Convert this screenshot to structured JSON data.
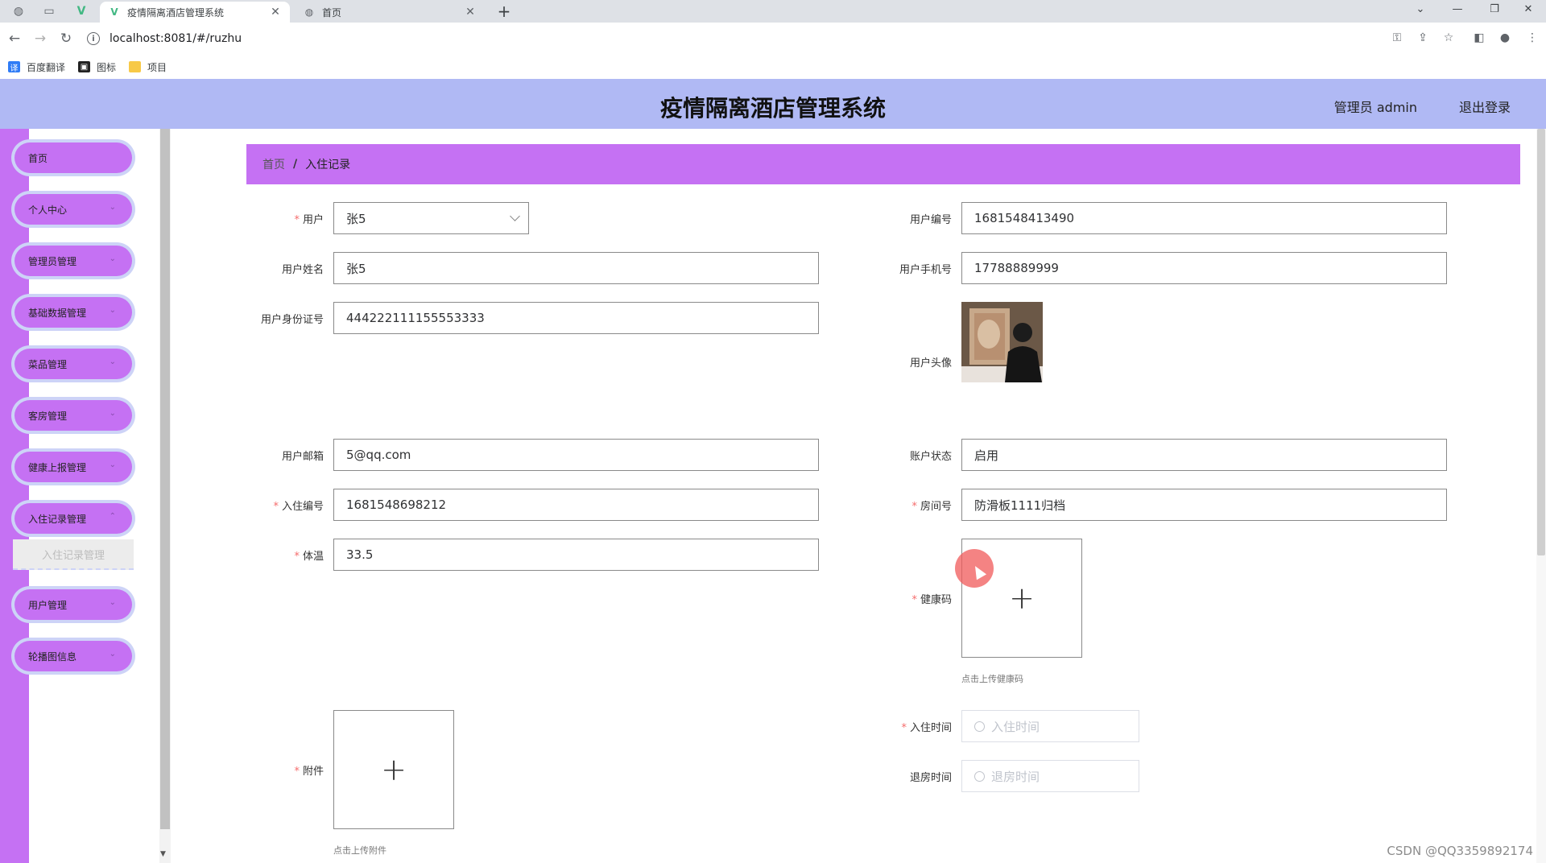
{
  "browser": {
    "tabs": [
      {
        "title": "疫情隔离酒店管理系统",
        "active": true
      },
      {
        "title": "首页",
        "active": false
      }
    ],
    "url": "localhost:8081/#/ruzhu",
    "bookmarks": [
      "百度翻译",
      "图标",
      "项目"
    ]
  },
  "header": {
    "title": "疫情隔离酒店管理系统",
    "admin_label": "管理员 admin",
    "logout_label": "退出登录"
  },
  "sidebar": {
    "items": [
      {
        "label": "首页",
        "has_chevron": false
      },
      {
        "label": "个人中心",
        "has_chevron": true
      },
      {
        "label": "管理员管理",
        "has_chevron": true
      },
      {
        "label": "基础数据管理",
        "has_chevron": true
      },
      {
        "label": "菜品管理",
        "has_chevron": true
      },
      {
        "label": "客房管理",
        "has_chevron": true
      },
      {
        "label": "健康上报管理",
        "has_chevron": true
      },
      {
        "label": "入住记录管理",
        "has_chevron": true
      },
      {
        "label": "用户管理",
        "has_chevron": true
      },
      {
        "label": "轮播图信息",
        "has_chevron": true
      }
    ],
    "submenu_active": "入住记录管理"
  },
  "breadcrumb": {
    "home": "首页",
    "current": "入住记录"
  },
  "form": {
    "user": {
      "label": "用户",
      "value": "张5",
      "required": true
    },
    "user_no": {
      "label": "用户编号",
      "value": "1681548413490"
    },
    "user_name": {
      "label": "用户姓名",
      "value": "张5"
    },
    "user_phone": {
      "label": "用户手机号",
      "value": "17788889999"
    },
    "user_id_card": {
      "label": "用户身份证号",
      "value": "444222111155553333"
    },
    "user_avatar": {
      "label": "用户头像"
    },
    "user_email": {
      "label": "用户邮箱",
      "value": "5@qq.com"
    },
    "account_status": {
      "label": "账户状态",
      "value": "启用"
    },
    "checkin_no": {
      "label": "入住编号",
      "value": "1681548698212",
      "required": true
    },
    "room_no": {
      "label": "房间号",
      "value": "防滑板1111归档",
      "required": true
    },
    "temperature": {
      "label": "体温",
      "value": "33.5",
      "required": true
    },
    "health_code": {
      "label": "健康码",
      "hint": "点击上传健康码",
      "required": true
    },
    "attachment": {
      "label": "附件",
      "hint": "点击上传附件",
      "required": true
    },
    "checkin_time": {
      "label": "入住时间",
      "placeholder": "入住时间",
      "required": true
    },
    "checkout_time": {
      "label": "退房时间",
      "placeholder": "退房时间"
    }
  },
  "watermark": "CSDN @QQ3359892174",
  "colors": {
    "header_bg": "#b0b9f4",
    "sidebar_accent": "#c571f3",
    "required": "#f56c6c"
  }
}
